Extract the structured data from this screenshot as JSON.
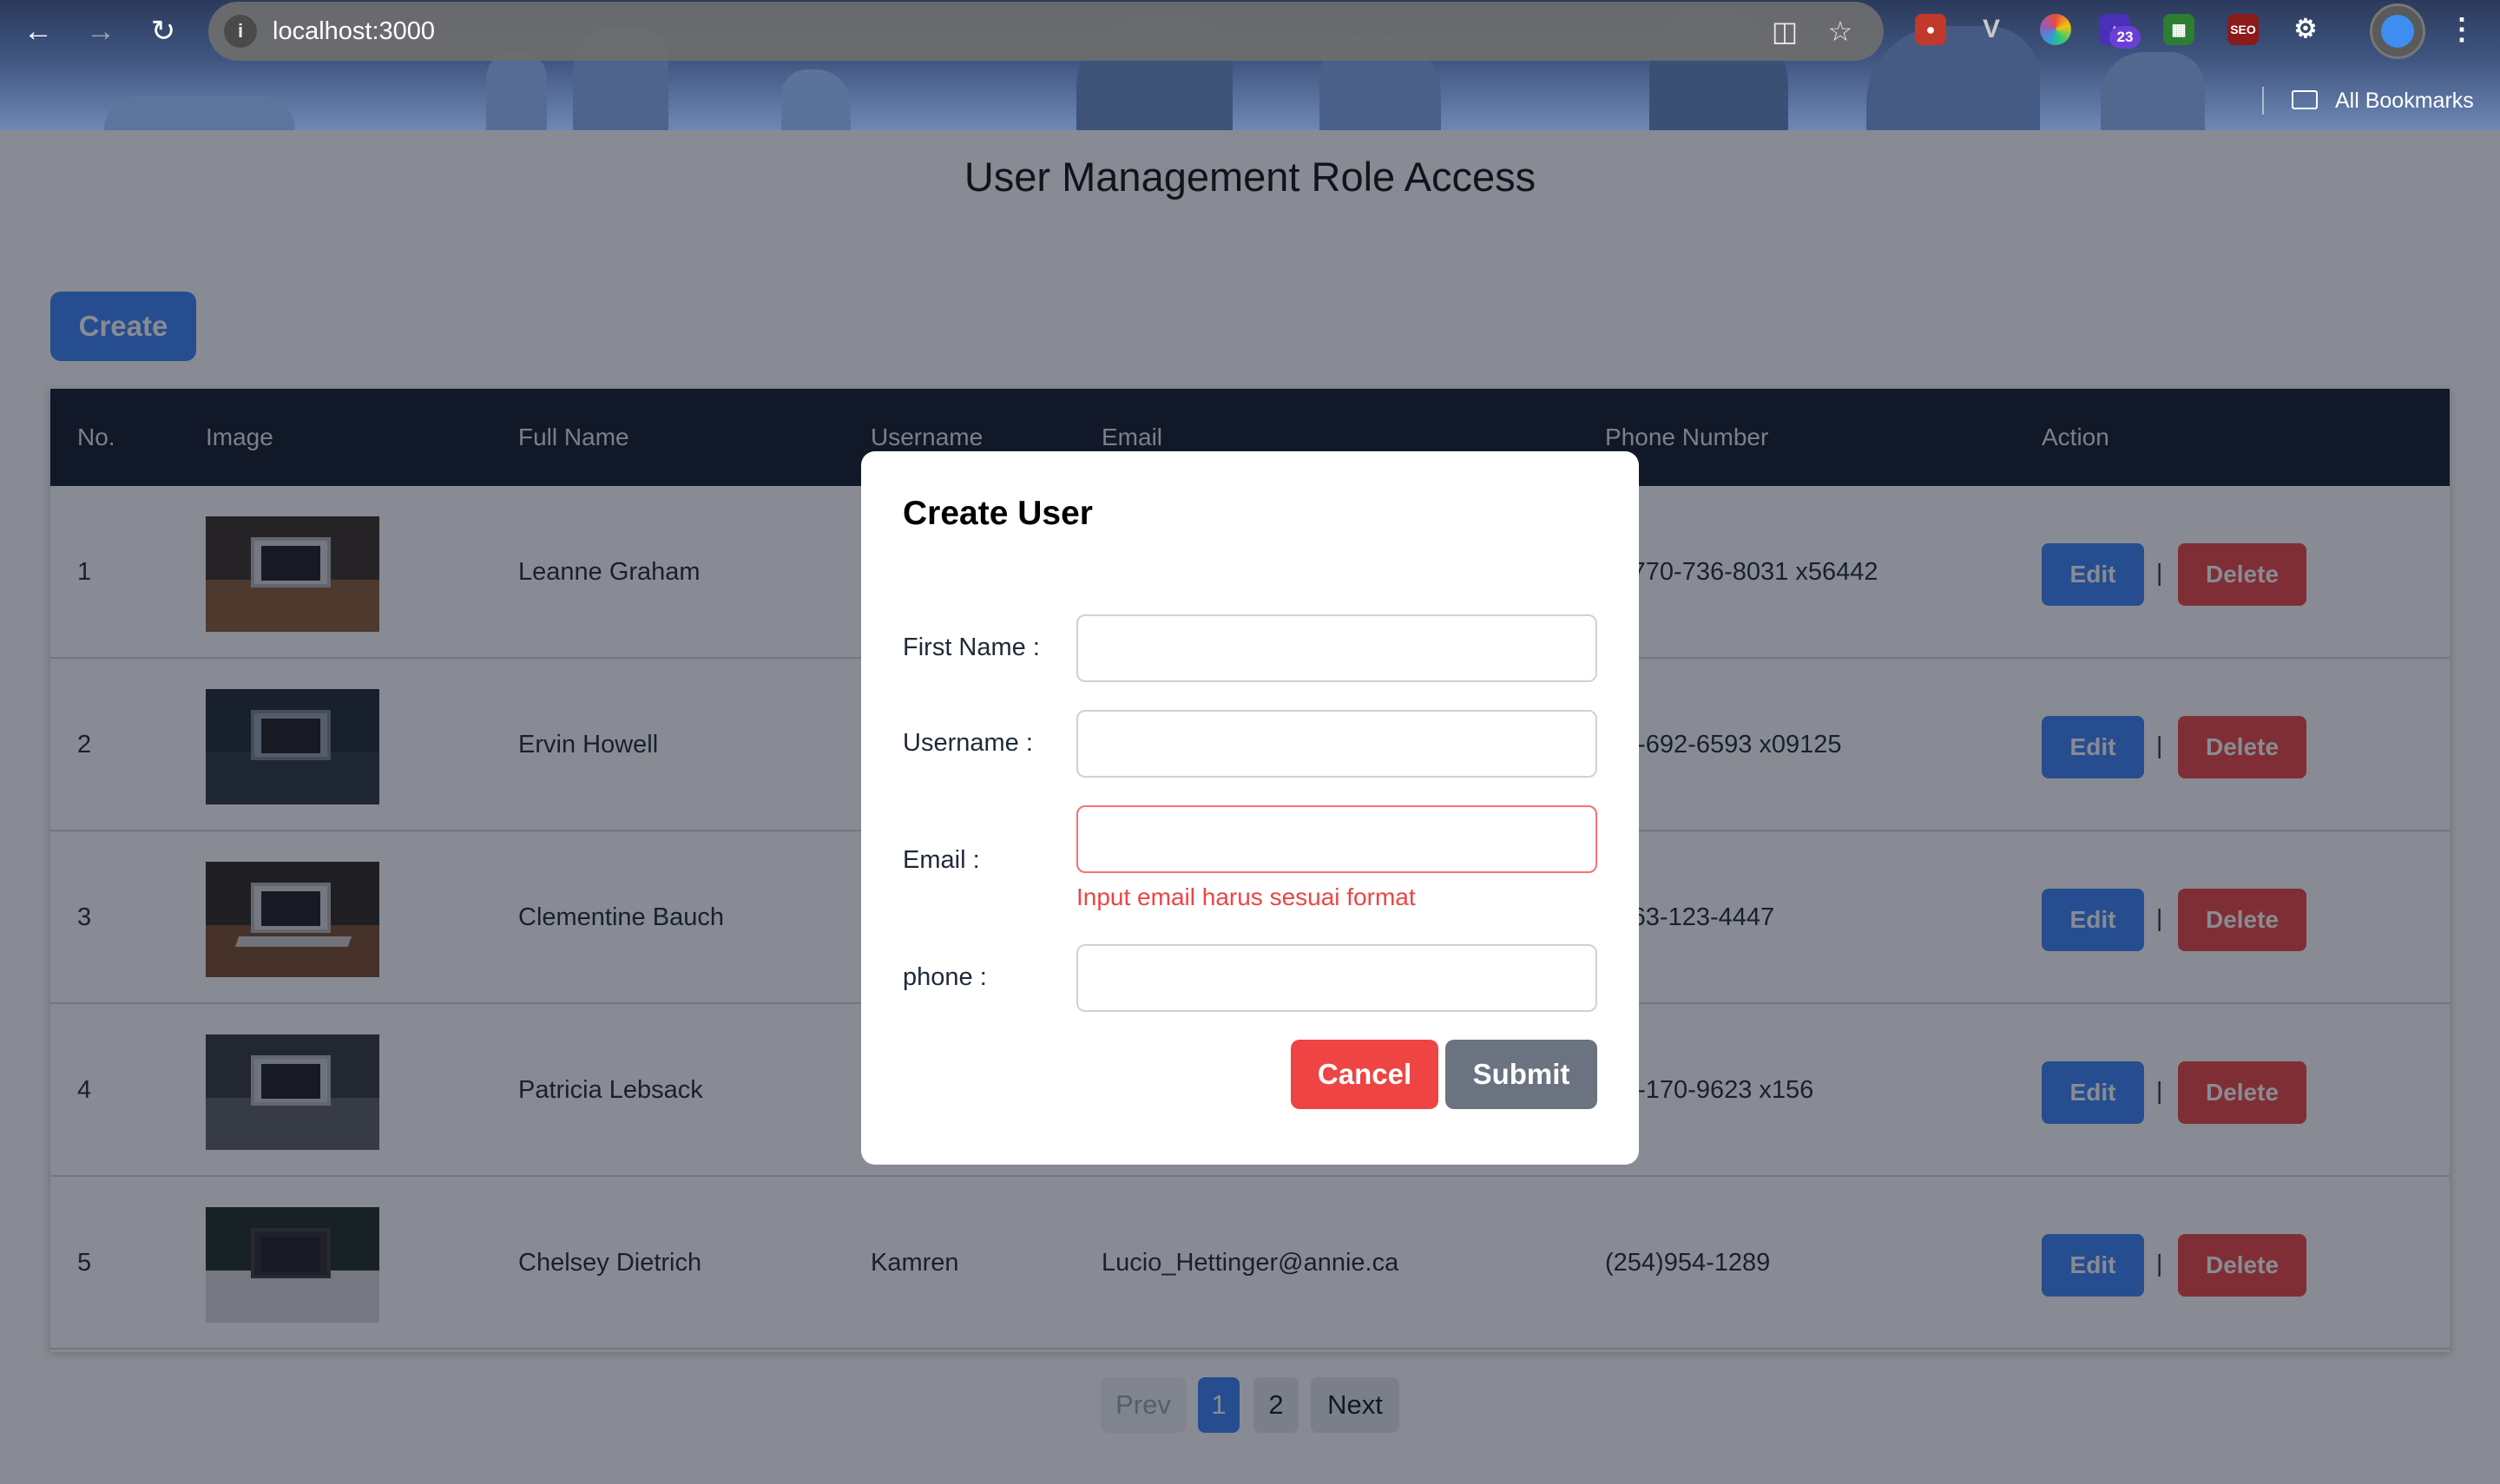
{
  "browser": {
    "url": "localhost:3000",
    "bookmarks_label": "All Bookmarks",
    "extension_badge": "23",
    "ext_seo_label": "SEO"
  },
  "page": {
    "title": "User Management Role Access",
    "create_label": "Create"
  },
  "table": {
    "headers": [
      "No.",
      "Image",
      "Full Name",
      "Username",
      "Email",
      "Phone Number",
      "Action"
    ],
    "rows": [
      {
        "no": "1",
        "full_name": "Leanne Graham",
        "username": "",
        "email": "",
        "phone": "-770-736-8031 x56442"
      },
      {
        "no": "2",
        "full_name": "Ervin Howell",
        "username": "",
        "email": "",
        "phone": "0-692-6593 x09125"
      },
      {
        "no": "3",
        "full_name": "Clementine Bauch",
        "username": "",
        "email": "",
        "phone": "-63-123-4447"
      },
      {
        "no": "4",
        "full_name": "Patricia Lebsack",
        "username": "",
        "email": "",
        "phone": "3-170-9623 x156"
      },
      {
        "no": "5",
        "full_name": "Chelsey Dietrich",
        "username": "Kamren",
        "email": "Lucio_Hettinger@annie.ca",
        "phone": "(254)954-1289"
      }
    ],
    "edit_label": "Edit",
    "delete_label": "Delete",
    "separator": "|"
  },
  "pagination": {
    "prev": "Prev",
    "pages": [
      "1",
      "2"
    ],
    "active_page": "1",
    "next": "Next"
  },
  "modal": {
    "title": "Create User",
    "fields": {
      "first_name": {
        "label": "First Name :",
        "value": ""
      },
      "username": {
        "label": "Username :",
        "value": ""
      },
      "email": {
        "label": "Email :",
        "value": "",
        "error": "Input email harus sesuai format"
      },
      "phone": {
        "label": "phone :",
        "value": ""
      }
    },
    "cancel_label": "Cancel",
    "submit_label": "Submit"
  },
  "colors": {
    "primary": "#3b82f6",
    "danger": "#ef4444",
    "secondary": "#6b7280",
    "table_header": "#111827"
  }
}
